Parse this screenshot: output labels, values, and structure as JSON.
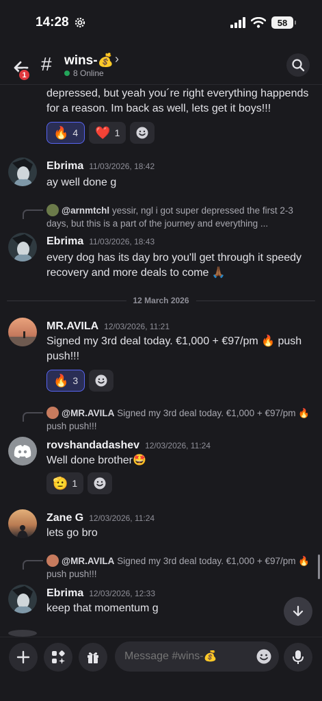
{
  "status_bar": {
    "time": "14:28",
    "battery": "58"
  },
  "header": {
    "back_badge": "1",
    "channel_name": "wins-💰",
    "chevron": "›",
    "online": "8 Online"
  },
  "top_partial": {
    "text": "depressed, but yeah you´re right everything happends for a reason. Im back as well, lets get it boys!!!",
    "reactions": [
      {
        "emoji": "🔥",
        "count": "4",
        "active": true
      },
      {
        "emoji": "❤️",
        "count": "1",
        "active": false
      }
    ]
  },
  "messages": [
    {
      "author": "Ebrima",
      "time": "11/03/2026, 18:42",
      "text": "ay well done g"
    },
    {
      "reply": {
        "author": "@arnmtchl",
        "text": "yessir, ngl i got super depressed the first 2-3 days, but this is a part of the journey and everything ..."
      },
      "author": "Ebrima",
      "time": "11/03/2026, 18:43",
      "text": "every dog has its day bro you'll get through it speedy recovery and more deals to come 🙏🏾"
    },
    {
      "author": "MR.AVILA",
      "time": "12/03/2026, 11:21",
      "text": "Signed my 3rd deal today. €1,000 + €97/pm 🔥 push push!!!",
      "reactions": [
        {
          "emoji": "🔥",
          "count": "3",
          "active": true
        }
      ]
    },
    {
      "reply": {
        "author": "@MR.AVILA",
        "text": "Signed my 3rd deal today. €1,000 + €97/pm 🔥 push push!!!"
      },
      "author": "rovshandadashev",
      "time": "12/03/2026, 11:24",
      "text": "Well done brother🤩",
      "reactions": [
        {
          "emoji": "🫡",
          "count": "1",
          "active": false
        }
      ]
    },
    {
      "author": "Zane G",
      "time": "12/03/2026, 11:24",
      "text": "lets go bro"
    },
    {
      "reply": {
        "author": "@MR.AVILA",
        "text": "Signed my 3rd deal today. €1,000 + €97/pm 🔥 push push!!!"
      },
      "author": "Ebrima",
      "time": "12/03/2026, 12:33",
      "text": "keep that momentum g"
    }
  ],
  "date_divider": "12 March 2026",
  "composer": {
    "placeholder": "Message #wins-💰"
  },
  "colors": {
    "accent": "#5865f2",
    "online": "#23a55a",
    "badge": "#e0393e",
    "background": "#1a1a1e"
  }
}
